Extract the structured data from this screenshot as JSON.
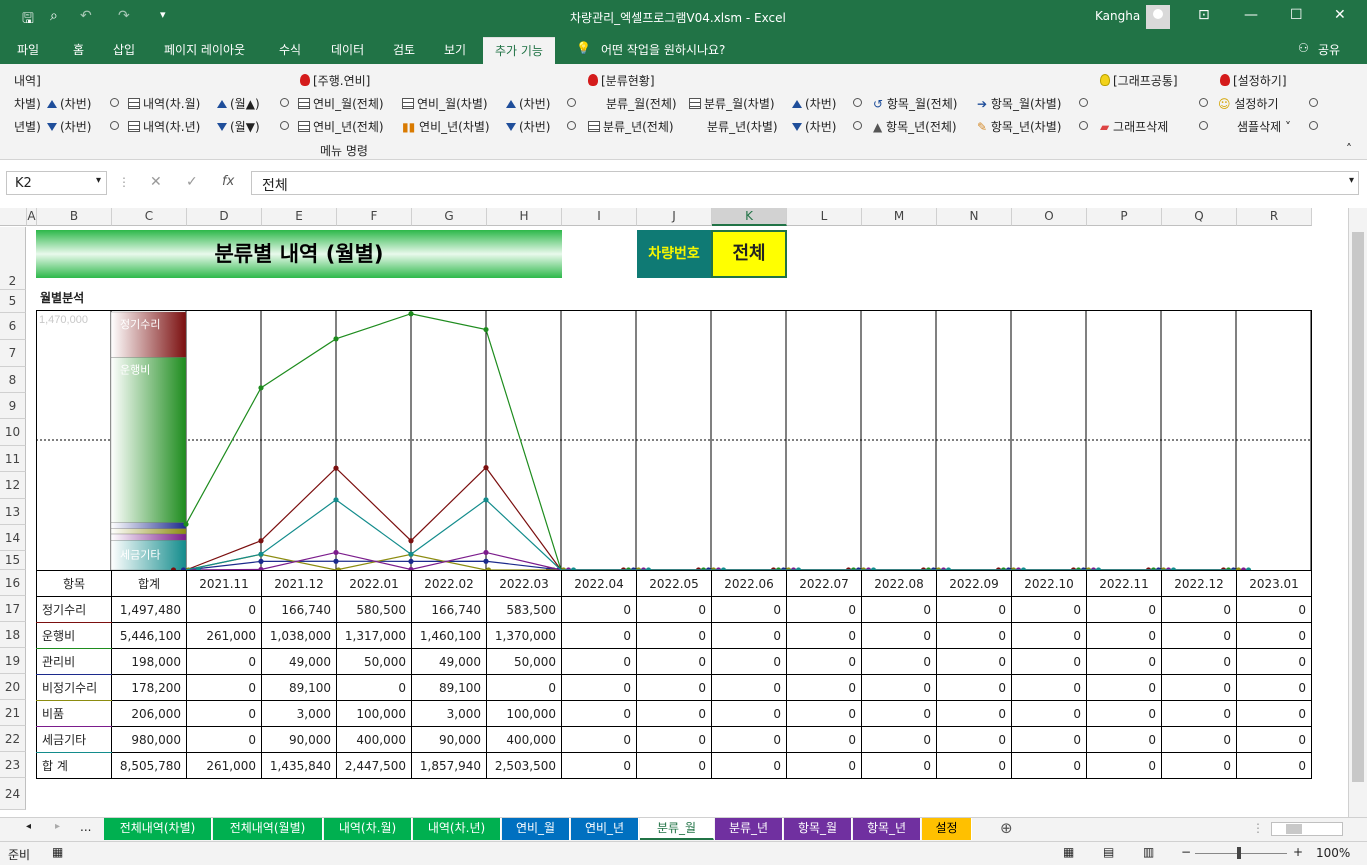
{
  "window": {
    "title": "차량관리_엑셀프로그램V04.xlsm  -  Excel",
    "user": "Kangha"
  },
  "menu_tabs": [
    "파일",
    "홈",
    "삽입",
    "페이지 레이아웃",
    "수식",
    "데이터",
    "검토",
    "보기",
    "추가 기능"
  ],
  "active_tab": "추가 기능",
  "tell_me": "어떤 작업을 원하시나요?",
  "share": "공유",
  "ribbon": {
    "group_caption": "메뉴 명령",
    "headers": {
      "left_cut": "내역]",
      "g1": "[주행.연비]",
      "g2": "[분류현황]",
      "g3": "[그래프공통]",
      "g4": "[설정하기]"
    },
    "row1": [
      "차별)",
      "(차번)",
      "내역(차.월)",
      "(월▲)",
      "연비_월(전체)",
      "연비_월(차별)",
      "(차번)",
      "분류_월(전체)",
      "분류_월(차별)",
      "(차번)",
      "항목_월(전체)",
      "항목_월(차별)",
      "설정하기"
    ],
    "row2": [
      "년별)",
      "(차번)",
      "내역(차.년)",
      "(월▼)",
      "연비_년(전체)",
      "연비_년(차별)",
      "(차번)",
      "분류_년(전체)",
      "분류_년(차별)",
      "(차번)",
      "항목_년(전체)",
      "항목_년(차별)",
      "그래프삭제",
      "샘플삭제"
    ]
  },
  "name_box": "K2",
  "formula_value": "전체",
  "columns": [
    "A",
    "B",
    "C",
    "D",
    "E",
    "F",
    "G",
    "H",
    "I",
    "J",
    "K",
    "L",
    "M",
    "N",
    "O",
    "P",
    "Q",
    "R"
  ],
  "rows": [
    "2",
    "5",
    "6",
    "7",
    "8",
    "9",
    "10",
    "11",
    "12",
    "13",
    "14",
    "15",
    "16",
    "17",
    "18",
    "19",
    "20",
    "21",
    "22",
    "23",
    "24"
  ],
  "sheet": {
    "title": "분류별 내역 (월별)",
    "car_label": "차량번호",
    "car_value": "전체",
    "section": "월별분석",
    "max_label": "1,470,000",
    "stack_labels": [
      "정기수리",
      "운행비",
      "세금기타"
    ]
  },
  "colors": {
    "excel_green": "#217346",
    "정기수리": "#7b0f0f",
    "운행비": "#1e8c1e",
    "관리비": "#1c2a8c",
    "비정기수리": "#8c8c10",
    "비품": "#7b1c8c",
    "세금기타": "#138c8c"
  },
  "chart_data": {
    "type": "line",
    "x": [
      "2021.11",
      "2021.12",
      "2022.01",
      "2022.02",
      "2022.03",
      "2022.04",
      "2022.05",
      "2022.06",
      "2022.07",
      "2022.08",
      "2022.09",
      "2022.10",
      "2022.11",
      "2022.12",
      "2023.01"
    ],
    "ylim": [
      0,
      1470000
    ],
    "series": [
      {
        "name": "정기수리",
        "values": [
          0,
          166740,
          580500,
          166740,
          583500,
          0,
          0,
          0,
          0,
          0,
          0,
          0,
          0,
          0,
          0
        ]
      },
      {
        "name": "운행비",
        "values": [
          261000,
          1038000,
          1317000,
          1460100,
          1370000,
          0,
          0,
          0,
          0,
          0,
          0,
          0,
          0,
          0,
          0
        ]
      },
      {
        "name": "관리비",
        "values": [
          0,
          49000,
          50000,
          49000,
          50000,
          0,
          0,
          0,
          0,
          0,
          0,
          0,
          0,
          0,
          0
        ]
      },
      {
        "name": "비정기수리",
        "values": [
          0,
          89100,
          0,
          89100,
          0,
          0,
          0,
          0,
          0,
          0,
          0,
          0,
          0,
          0,
          0
        ]
      },
      {
        "name": "비품",
        "values": [
          0,
          3000,
          100000,
          3000,
          100000,
          0,
          0,
          0,
          0,
          0,
          0,
          0,
          0,
          0,
          0
        ]
      },
      {
        "name": "세금기타",
        "values": [
          0,
          90000,
          400000,
          90000,
          400000,
          0,
          0,
          0,
          0,
          0,
          0,
          0,
          0,
          0,
          0
        ]
      }
    ],
    "stacked_total": [
      {
        "name": "정기수리",
        "value": 1497480
      },
      {
        "name": "운행비",
        "value": 5446100
      },
      {
        "name": "관리비",
        "value": 198000
      },
      {
        "name": "비정기수리",
        "value": 178200
      },
      {
        "name": "비품",
        "value": 206000
      },
      {
        "name": "세금기타",
        "value": 980000
      }
    ]
  },
  "table": {
    "header": [
      "항목",
      "합계",
      "2021.11",
      "2021.12",
      "2022.01",
      "2022.02",
      "2022.03",
      "2022.04",
      "2022.05",
      "2022.06",
      "2022.07",
      "2022.08",
      "2022.09",
      "2022.10",
      "2022.11",
      "2022.12",
      "2023.01"
    ],
    "rows": [
      [
        "정기수리",
        "1,497,480",
        "0",
        "166,740",
        "580,500",
        "166,740",
        "583,500",
        "0",
        "0",
        "0",
        "0",
        "0",
        "0",
        "0",
        "0",
        "0",
        "0"
      ],
      [
        "운행비",
        "5,446,100",
        "261,000",
        "1,038,000",
        "1,317,000",
        "1,460,100",
        "1,370,000",
        "0",
        "0",
        "0",
        "0",
        "0",
        "0",
        "0",
        "0",
        "0",
        "0"
      ],
      [
        "관리비",
        "198,000",
        "0",
        "49,000",
        "50,000",
        "49,000",
        "50,000",
        "0",
        "0",
        "0",
        "0",
        "0",
        "0",
        "0",
        "0",
        "0",
        "0"
      ],
      [
        "비정기수리",
        "178,200",
        "0",
        "89,100",
        "0",
        "89,100",
        "0",
        "0",
        "0",
        "0",
        "0",
        "0",
        "0",
        "0",
        "0",
        "0",
        "0"
      ],
      [
        "비품",
        "206,000",
        "0",
        "3,000",
        "100,000",
        "3,000",
        "100,000",
        "0",
        "0",
        "0",
        "0",
        "0",
        "0",
        "0",
        "0",
        "0",
        "0"
      ],
      [
        "세금기타",
        "980,000",
        "0",
        "90,000",
        "400,000",
        "90,000",
        "400,000",
        "0",
        "0",
        "0",
        "0",
        "0",
        "0",
        "0",
        "0",
        "0",
        "0"
      ],
      [
        "합 계",
        "8,505,780",
        "261,000",
        "1,435,840",
        "2,447,500",
        "1,857,940",
        "2,503,500",
        "0",
        "0",
        "0",
        "0",
        "0",
        "0",
        "0",
        "0",
        "0",
        "0"
      ]
    ]
  },
  "sheet_tabs": [
    {
      "label": "전체내역(차별)",
      "color": "#00b050"
    },
    {
      "label": "전체내역(월별)",
      "color": "#00b050"
    },
    {
      "label": "내역(차.월)",
      "color": "#00b050"
    },
    {
      "label": "내역(차.년)",
      "color": "#00b050"
    },
    {
      "label": "연비_월",
      "color": "#0070c0"
    },
    {
      "label": "연비_년",
      "color": "#0070c0"
    },
    {
      "label": "분류_월",
      "color": "#ffffff"
    },
    {
      "label": "분류_년",
      "color": "#7030a0"
    },
    {
      "label": "항목_월",
      "color": "#7030a0"
    },
    {
      "label": "항목_년",
      "color": "#7030a0"
    },
    {
      "label": "설정",
      "color": "#ffc000"
    }
  ],
  "tab_more": "...",
  "status": {
    "ready": "준비",
    "zoom": "100%"
  }
}
